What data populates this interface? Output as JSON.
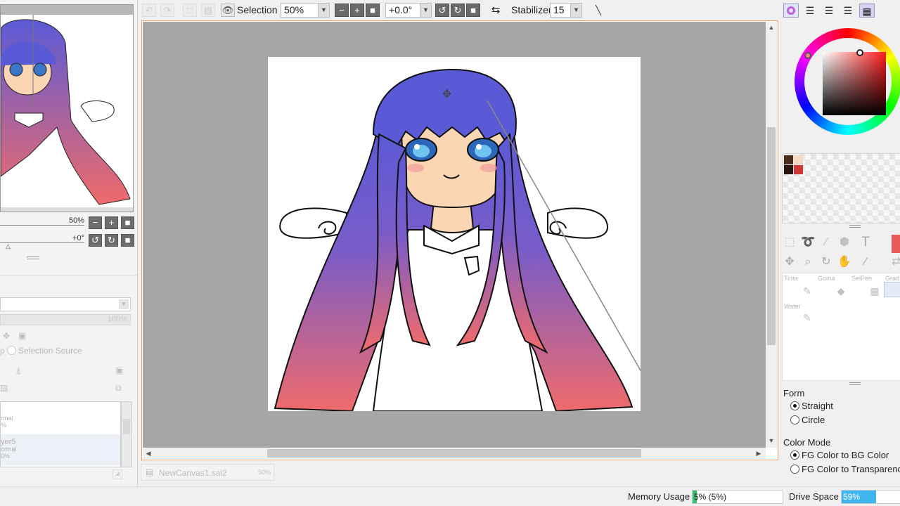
{
  "toolbar": {
    "selection_label": "Selection",
    "zoom_value": "50%",
    "rotation_value": "+0.0°",
    "stabilizer_label": "Stabilizer",
    "stabilizer_value": "15"
  },
  "navigator": {
    "zoom_value": "50%",
    "rotation_value": "+0°"
  },
  "layer_panel": {
    "opacity_value": "100%",
    "selection_source_label": "Selection Source",
    "layers": [
      {
        "name": "",
        "mode": "rmal",
        "opacity": "%"
      },
      {
        "name": "yer5",
        "mode": "ormal",
        "opacity": "0%"
      }
    ]
  },
  "color_panel": {
    "current_color": "#e8595c",
    "swatches": [
      "#4a2a1a",
      "#f5d8c0",
      "#2a1410",
      "#d03838"
    ]
  },
  "brush_panel": {
    "brushes": [
      "Tinta",
      "Goma",
      "SelPen",
      "Grad",
      "Water"
    ]
  },
  "form": {
    "title": "Form",
    "options": [
      "Straight",
      "Circle"
    ],
    "selected": "Straight"
  },
  "color_mode": {
    "title": "Color Mode",
    "options": [
      "FG Color to BG Color",
      "FG Color to Transparenc"
    ],
    "selected": "FG Color to BG Color"
  },
  "file_tab": {
    "name": "NewCanvas1.sai2",
    "zoom": "50%"
  },
  "status": {
    "memory_label": "Memory Usage",
    "memory_value": "5% (5%)",
    "memory_fraction": 0.05,
    "drive_label": "Drive Space",
    "drive_value": "59%",
    "drive_fraction": 0.59
  },
  "colors": {
    "hair_top": "#5b5ad6",
    "hair_bottom": "#ef6b6b",
    "canvas_bg": "#a6a6a6",
    "accent_border": "#f0a060",
    "drive_fill": "#3fb5f0",
    "memory_fill": "#34c06a"
  }
}
